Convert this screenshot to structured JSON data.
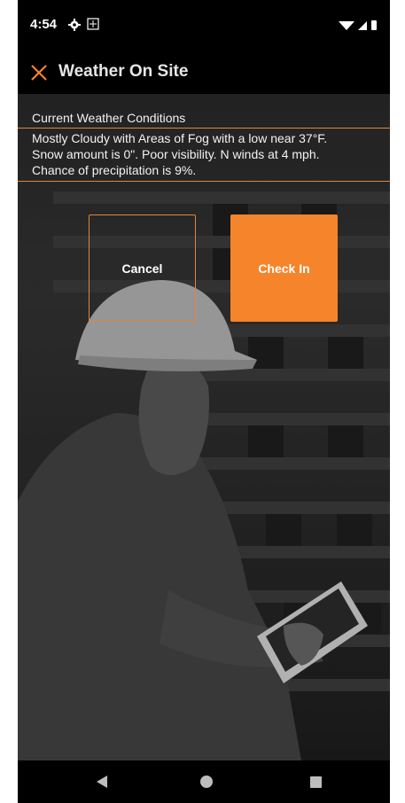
{
  "status_bar": {
    "time": "4:54",
    "icons": [
      "gear-icon",
      "app-notification-icon",
      "wifi-icon",
      "signal-icon",
      "battery-icon"
    ]
  },
  "app_bar": {
    "title": "Weather On Site",
    "close_icon": "close-icon",
    "accent_color": "#f5842a"
  },
  "weather": {
    "heading": "Current Weather Conditions",
    "lines": [
      "Mostly Cloudy with Areas of Fog with a low near 37°F.",
      "Snow amount is 0\". Poor visibility. N winds at 4 mph.",
      "Chance of precipitation is 9%."
    ]
  },
  "buttons": {
    "cancel_label": "Cancel",
    "checkin_label": "Check In",
    "checkin_color": "#f5842a",
    "cancel_border_color": "#e2853a"
  },
  "nav_bar": {
    "icons": [
      "back-icon",
      "home-icon",
      "recent-apps-icon"
    ]
  }
}
